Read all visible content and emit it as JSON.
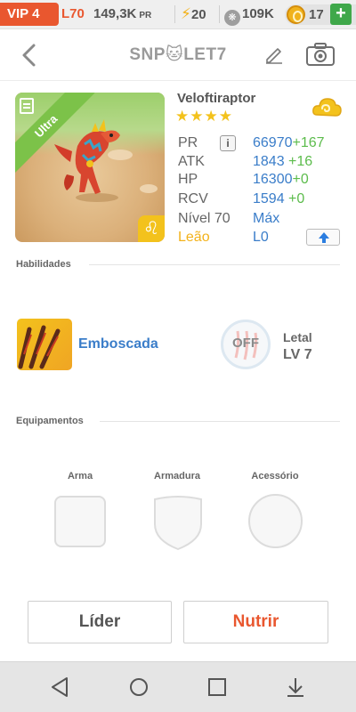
{
  "status_bar": {
    "vip": "VIP 4",
    "level": "L70",
    "power": "149,3K",
    "power_unit": "PR",
    "energy": "20",
    "paw_food": "109K",
    "coins": "17",
    "add_label": "+"
  },
  "header": {
    "title": "SNP🐱LET7"
  },
  "monster": {
    "name": "Veloftiraptor",
    "stars": "★★★★",
    "rarity": "Ultra",
    "sign_glyph": "♌",
    "stats": {
      "pr_label": "PR",
      "pr_value": "66970",
      "pr_bonus": "+167",
      "atk_label": "ATK",
      "atk_value": "1843",
      "atk_bonus": "+16",
      "hp_label": "HP",
      "hp_value": "16300",
      "hp_bonus": "+0",
      "rcv_label": "RCV",
      "rcv_value": "1594",
      "rcv_bonus": "+0",
      "level_label": "Nível 70",
      "level_value": "Máx",
      "sign_label": "Leão",
      "sign_value": "L0",
      "info_label": "i"
    }
  },
  "abilities": {
    "section_title": "Habilidades",
    "skill_name": "Emboscada",
    "toggle_label": "OFF",
    "lethal_label": "Letal",
    "lethal_level": "LV 7"
  },
  "equipment": {
    "section_title": "Equipamentos",
    "weapon_label": "Arma",
    "armor_label": "Armadura",
    "accessory_label": "Acessório"
  },
  "actions": {
    "leader_label": "Líder",
    "feed_label": "Nutrir"
  },
  "colors": {
    "accent_red": "#e9572f",
    "stat_blue": "#3a7dc9",
    "bonus_green": "#5cbc4c",
    "star_gold": "#f3c21c",
    "ultra_green": "#7cc249"
  }
}
